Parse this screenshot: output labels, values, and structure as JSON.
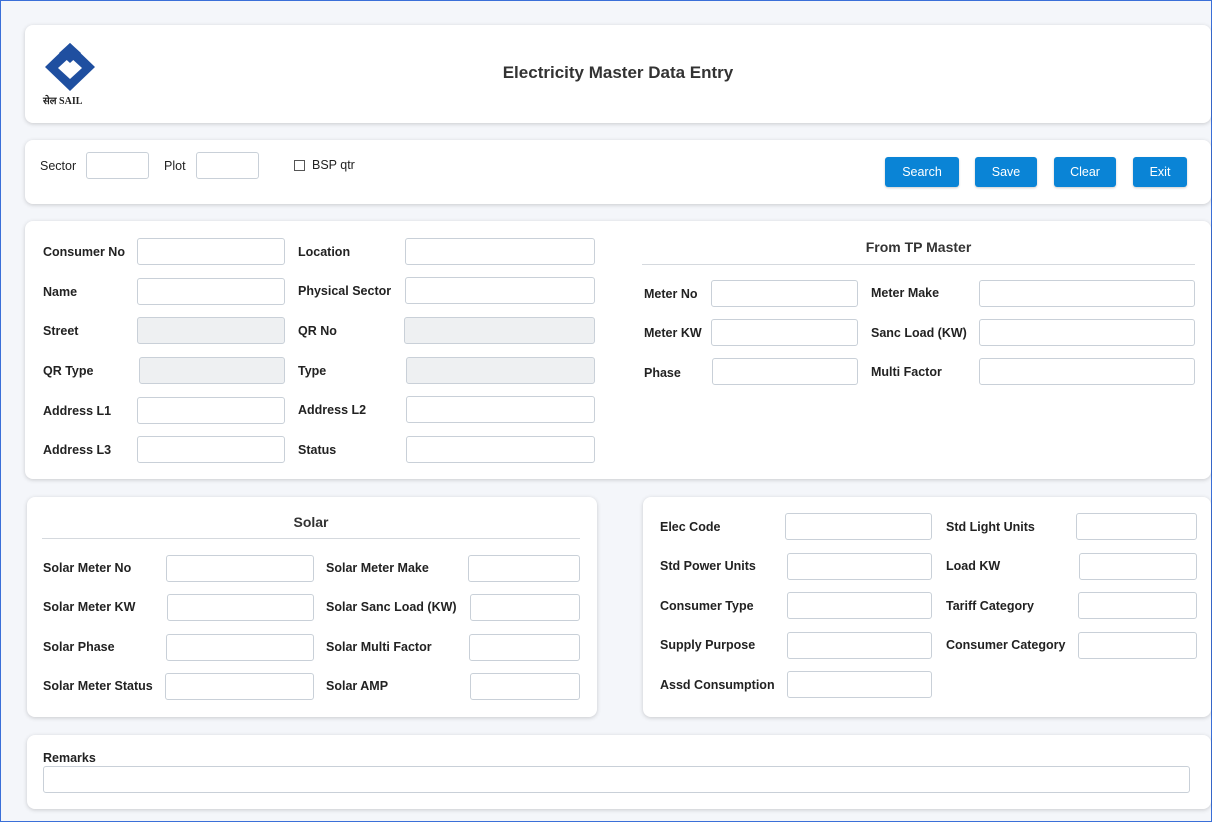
{
  "header": {
    "title": "Electricity Master Data Entry",
    "logo_text": "सेल SAIL",
    "logo_color": "#1f4fa0"
  },
  "toolbar": {
    "sector_label": "Sector",
    "sector_value": "",
    "plot_label": "Plot",
    "plot_value": "",
    "bsp_label": "BSP qtr",
    "bsp_checked": false,
    "search_label": "Search",
    "save_label": "Save",
    "clear_label": "Clear",
    "exit_label": "Exit",
    "button_color": "#0a84d6"
  },
  "consumer": {
    "consumer_no": "Consumer No",
    "location": "Location",
    "name": "Name",
    "physical_sector": "Physical Sector",
    "street": "Street",
    "qr_no": "QR No",
    "qr_type": "QR Type",
    "type": "Type",
    "address_l1": "Address L1",
    "address_l2": "Address L2",
    "address_l3": "Address L3",
    "status": "Status"
  },
  "tp_master": {
    "title": "From TP Master",
    "meter_no": "Meter No",
    "meter_make": "Meter Make",
    "meter_kw": "Meter KW",
    "sanc_load": "Sanc Load (KW)",
    "phase": "Phase",
    "multi_factor": "Multi Factor"
  },
  "solar": {
    "title": "Solar",
    "meter_no": "Solar Meter No",
    "meter_make": "Solar Meter Make",
    "meter_kw": "Solar Meter KW",
    "sanc_load": "Solar Sanc Load (KW)",
    "phase": "Solar Phase",
    "multi_factor": "Solar Multi Factor",
    "meter_status": "Solar Meter Status",
    "amp": "Solar AMP"
  },
  "elec": {
    "elec_code": "Elec Code",
    "std_light_units": "Std Light Units",
    "std_power_units": "Std Power Units",
    "load_kw": "Load KW",
    "consumer_type": "Consumer Type",
    "tariff_category": "Tariff Category",
    "supply_purpose": "Supply Purpose",
    "consumer_category": "Consumer Category",
    "assd_consumption": "Assd Consumption"
  },
  "remarks": {
    "label": "Remarks",
    "value": ""
  }
}
